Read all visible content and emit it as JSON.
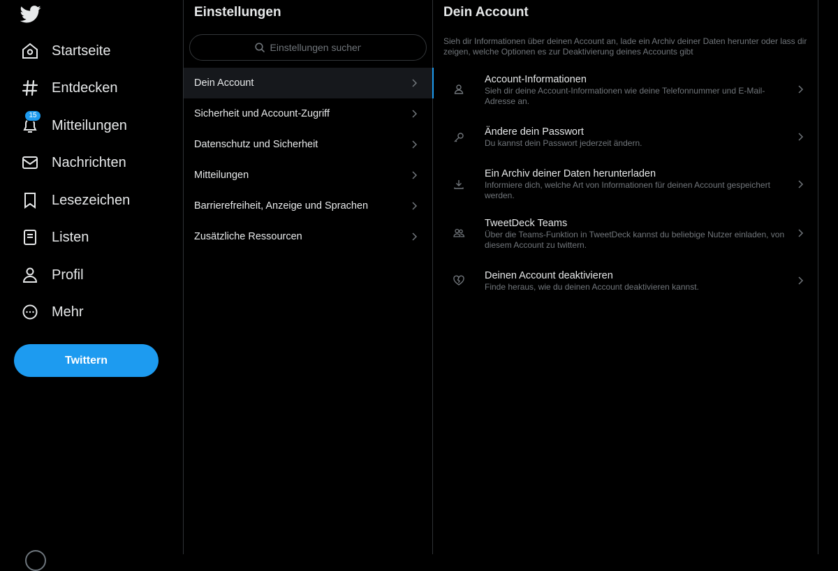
{
  "nav": {
    "items": [
      {
        "label": "Startseite"
      },
      {
        "label": "Entdecken"
      },
      {
        "label": "Mitteilungen",
        "badge": "15"
      },
      {
        "label": "Nachrichten"
      },
      {
        "label": "Lesezeichen"
      },
      {
        "label": "Listen"
      },
      {
        "label": "Profil"
      },
      {
        "label": "Mehr"
      }
    ],
    "tweet_button": "Twittern"
  },
  "settings": {
    "title": "Einstellungen",
    "search_placeholder": "Einstellungen suchen",
    "items": [
      {
        "label": "Dein Account",
        "active": true
      },
      {
        "label": "Sicherheit und Account-Zugriff"
      },
      {
        "label": "Datenschutz und Sicherheit"
      },
      {
        "label": "Mitteilungen"
      },
      {
        "label": "Barrierefreiheit, Anzeige und Sprachen"
      },
      {
        "label": "Zusätzliche Ressourcen"
      }
    ]
  },
  "detail": {
    "title": "Dein Account",
    "intro": "Sieh dir Informationen über deinen Account an, lade ein Archiv deiner Daten herunter oder lass dir zeigen, welche Optionen es zur Deaktivierung deines Accounts gibt",
    "items": [
      {
        "title": "Account-Informationen",
        "desc": "Sieh dir deine Account-Informationen wie deine Telefonnummer und E-Mail-Adresse an.",
        "icon": "person-icon"
      },
      {
        "title": "Ändere dein Passwort",
        "desc": "Du kannst dein Passwort jederzeit ändern.",
        "icon": "key-icon"
      },
      {
        "title": "Ein Archiv deiner Daten herunterladen",
        "desc": "Informiere dich, welche Art von Informationen für deinen Account gespeichert werden.",
        "icon": "download-icon"
      },
      {
        "title": "TweetDeck Teams",
        "desc": "Über die Teams-Funktion in TweetDeck kannst du beliebige Nutzer einladen, von diesem Account zu twittern.",
        "icon": "people-icon"
      },
      {
        "title": "Deinen Account deaktivieren",
        "desc": "Finde heraus, wie du deinen Account deaktivieren kannst.",
        "icon": "broken-heart-icon"
      }
    ]
  },
  "colors": {
    "accent": "#1d9bf0",
    "background": "#000000",
    "text": "#e7e9ea",
    "muted": "#71767b",
    "border": "#2f3336"
  }
}
